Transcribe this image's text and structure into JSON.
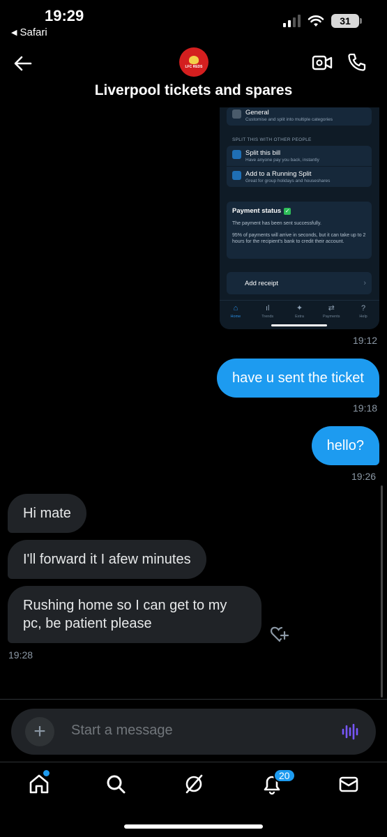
{
  "status_bar": {
    "time": "19:29",
    "back_app": "Safari",
    "battery": "31"
  },
  "header": {
    "title": "Liverpool tickets and spares",
    "avatar_text": "LFC REDS"
  },
  "shared_screenshot": {
    "general": {
      "title": "General",
      "subtitle": "Customise and split into multiple categories"
    },
    "section_label": "SPLIT THIS WITH OTHER PEOPLE",
    "split_bill": {
      "title": "Split this bill",
      "subtitle": "Have anyone pay you back, instantly"
    },
    "running_split": {
      "title": "Add to a Running Split",
      "subtitle": "Great for group holidays and houseshares"
    },
    "payment_status": {
      "title": "Payment status",
      "line1": "The payment has been sent successfully.",
      "line2": "95% of payments will arrive in seconds, but it can take up to 2 hours for the recipient's bank to credit their account."
    },
    "receipt_label": "Add receipt",
    "tabs": [
      "Home",
      "Trends",
      "Extra",
      "Payments",
      "Help"
    ]
  },
  "messages": {
    "ts1": "19:12",
    "m1": "have u sent the ticket",
    "ts2": "19:18",
    "m2": "hello?",
    "ts3": "19:26",
    "r1": "Hi mate",
    "r2": "I'll forward it I afew minutes",
    "r3": "Rushing home so I can get to my pc, be patient please",
    "ts4": "19:28"
  },
  "composer": {
    "placeholder": "Start a message"
  },
  "nav": {
    "notifications_count": "20"
  },
  "colors": {
    "accent": "#1d9bf0",
    "background": "#000000",
    "incoming_bubble": "#202327"
  }
}
